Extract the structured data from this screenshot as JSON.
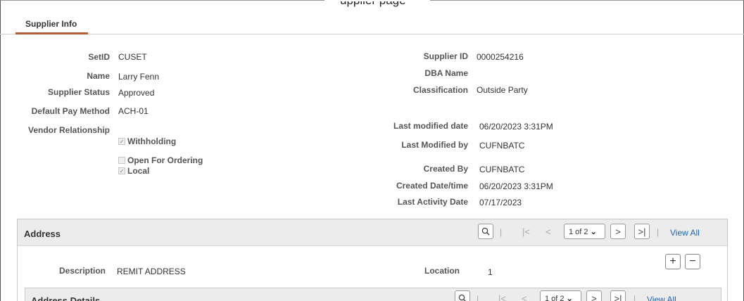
{
  "page": {
    "top_fragment": "upplier page"
  },
  "tabs": [
    {
      "label": "Supplier Info"
    }
  ],
  "left_fields": {
    "setid": {
      "label": "SetID",
      "value": "CUSET"
    },
    "name": {
      "label": "Name",
      "value": "Larry Fenn"
    },
    "supplier_status": {
      "label": "Supplier Status",
      "value": "Approved"
    },
    "default_pay_method": {
      "label": "Default Pay Method",
      "value": "ACH-01"
    },
    "vendor_relationship": {
      "label": "Vendor Relationship"
    }
  },
  "checkboxes": {
    "withholding": {
      "label": "Withholding",
      "checked": true
    },
    "open_for_ordering": {
      "label": "Open For Ordering",
      "checked": false
    },
    "local": {
      "label": "Local",
      "checked": true
    }
  },
  "right_fields": {
    "supplier_id": {
      "label": "Supplier ID",
      "value": "0000254216"
    },
    "dba_name": {
      "label": "DBA Name",
      "value": ""
    },
    "classification": {
      "label": "Classification",
      "value": "Outside Party"
    },
    "last_modified_date": {
      "label": "Last modified date",
      "value": "06/20/2023  3:31PM"
    },
    "last_modified_by": {
      "label": "Last Modified by",
      "value": "CUFNBATC"
    },
    "created_by": {
      "label": "Created By",
      "value": "CUFNBATC"
    },
    "created_datetime": {
      "label": "Created Date/time",
      "value": "06/20/2023  3:31PM"
    },
    "last_activity_date": {
      "label": "Last Activity Date",
      "value": "07/17/2023"
    }
  },
  "address": {
    "title": "Address",
    "pager": {
      "value": "1 of 2",
      "view_all": "View All"
    },
    "description": {
      "label": "Description",
      "value": "REMIT ADDRESS"
    },
    "location": {
      "label": "Location",
      "value": "1"
    },
    "details": {
      "title": "Address Details",
      "pager": {
        "value": "1 of 2",
        "view_all": "View All"
      }
    }
  },
  "glyphs": {
    "check": "✓",
    "search": "🔍",
    "first": "|<",
    "prev": "<",
    "next": ">",
    "last": ">|",
    "chevron": "⌄",
    "sep": "|",
    "plus": "+",
    "minus": "−"
  }
}
